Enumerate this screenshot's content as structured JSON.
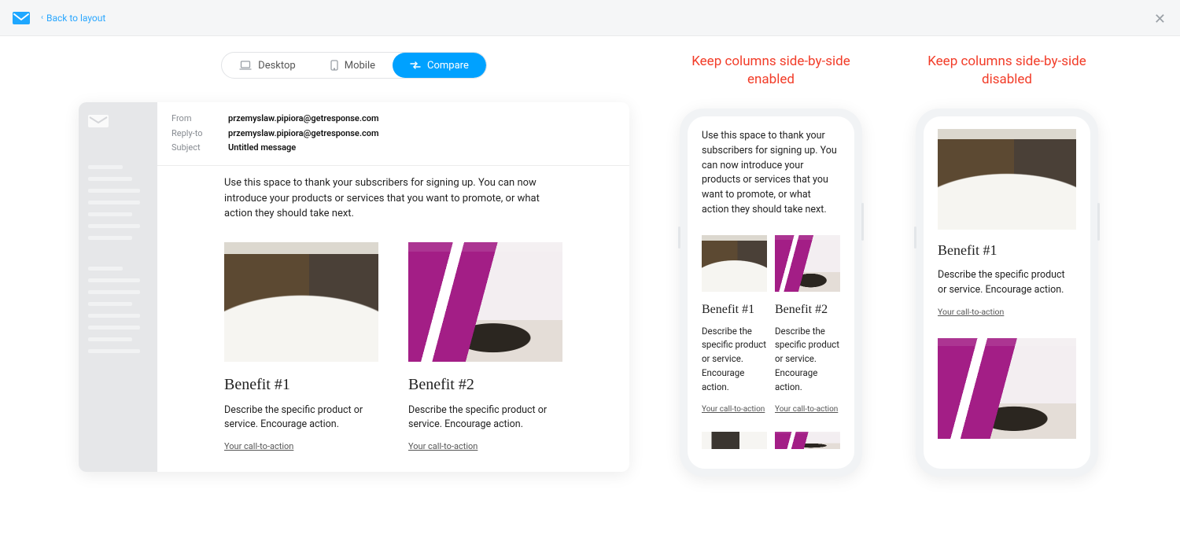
{
  "header": {
    "back_label": "Back to layout"
  },
  "toggle": {
    "desktop": "Desktop",
    "mobile": "Mobile",
    "compare": "Compare"
  },
  "email_headers": {
    "from_lbl": "From",
    "from_val": "przemyslaw.pipiora@getresponse.com",
    "reply_lbl": "Reply-to",
    "reply_val": "przemyslaw.pipiora@getresponse.com",
    "subject_lbl": "Subject",
    "subject_val": "Untitled message"
  },
  "content": {
    "intro": "Use this space to thank your subscribers for signing up. You can now introduce your products or services that you want to promote, or what action they should take next.",
    "benefit1_h": "Benefit #1",
    "benefit2_h": "Benefit #2",
    "benefit_p": "Describe the specific product or service. Encourage action.",
    "cta": "Your call-to-action"
  },
  "labels": {
    "enabled_title": "Keep columns side-by-side enabled",
    "disabled_title": "Keep columns side-by-side disabled"
  }
}
